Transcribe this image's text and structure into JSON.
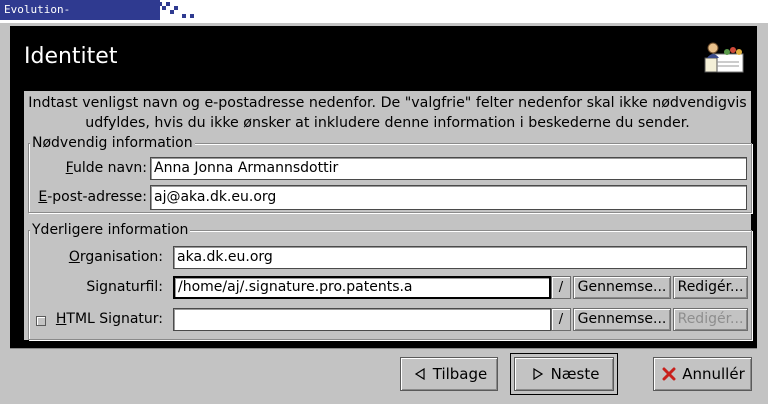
{
  "window": {
    "title": "Evolution-kontoassistent"
  },
  "header": {
    "title": "Identitet",
    "logo_icon": "evolution-logo-icon"
  },
  "intro": {
    "text": "Indtast venligst navn og e-postadresse nedenfor. De \"valgfrie\" felter nedenfor skal ikke nødvendigvis\nudfyldes, hvis du ikke ønsker at inkludere denne information i beskederne du sender."
  },
  "required": {
    "legend": "Nødvendig information",
    "fullname_label_u": "F",
    "fullname_label_rest": "ulde navn:",
    "fullname_value": "Anna Jonna Armannsdottir",
    "email_label_u": "E",
    "email_label_rest": "-post-adresse:",
    "email_value": "aj@aka.dk.eu.org"
  },
  "optional": {
    "legend": "Yderligere information",
    "org_label_u": "O",
    "org_label_rest": "rganisation:",
    "org_value": "aka.dk.eu.org",
    "sigfile_label": "Signaturfil:",
    "sigfile_value": "/home/aj/.signature.pro.patents.a",
    "sigfile_combo_glyph": "/",
    "browse_label": "Gennemse...",
    "edit_label": "Redigér...",
    "html_sig_label_u": "H",
    "html_sig_label_rest": "TML Signatur:",
    "html_sig_value": "",
    "html_sig_combo_glyph": "/",
    "html_browse_label": "Gennemse...",
    "html_edit_label": "Redigér..."
  },
  "buttons": {
    "back_label": "Tilbage",
    "next_label": "Næste",
    "cancel_label": "Annullér"
  },
  "colors": {
    "title_tab": "#2f3a90",
    "header_bg": "#000000",
    "window_bg": "#c3c3c3",
    "cancel_icon": "#c8201c"
  }
}
